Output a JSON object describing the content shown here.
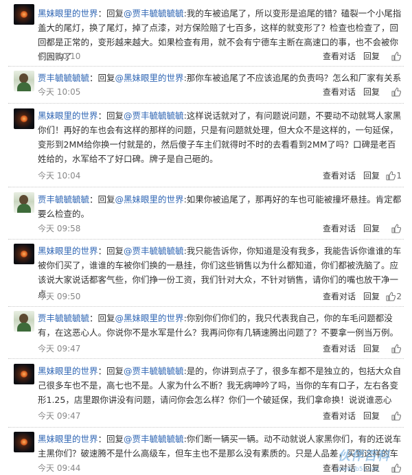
{
  "comments": [
    {
      "user": "黑妹眼里的世界",
      "sep": "：",
      "reply_prefix": "回复",
      "mention": "@贾丰毓毓毓毓",
      "text": ":我的车被追尾了，所以变形是追尾的错？磕裂一个小尾指盖大的尾灯，换了尾灯，掉了点漆，对方保险赔了七百多，这样的就变形了？检查也检查了，回回都是正常的，变形越来越大。如果检查有用，就不会有宁德车主断在高速口的事，也不会被你们回购了",
      "time": "今天 10:10",
      "view": "查看对话",
      "reply": "回复",
      "likes": ""
    },
    {
      "user": "贾丰毓毓毓毓",
      "sep": "：",
      "reply_prefix": "回复",
      "mention": "@黑妹眼里的世界",
      "text": ":那你车被追尾了不应该追尾的负责吗？怎么和厂家有关系",
      "time": "今天 10:05",
      "view": "查看对话",
      "reply": "回复",
      "likes": ""
    },
    {
      "user": "黑妹眼里的世界",
      "sep": "：",
      "reply_prefix": "回复",
      "mention": "@贾丰毓毓毓毓",
      "text": ":这样说话就对了，有问题说问题，不要动不动就骂人家黑你们！再好的车也会有这样的那样的问题，只是有问题就处理，但大众不是这样的，一句延保，变形到2MM给你换一付就是的，然后傻子车主们就得时不时的去看看到2MM了吗？口碑是老百姓给的，水军给不了好口碑。牌子是自己砸的。",
      "time": "今天 10:04",
      "view": "查看对话",
      "reply": "回复",
      "likes": "1"
    },
    {
      "user": "贾丰毓毓毓毓",
      "sep": "：",
      "reply_prefix": "回复",
      "mention": "@黑妹眼里的世界",
      "text": ":如果你被追尾了，那再好的车也可能被撞坏悬挂。肯定都要么检查的。",
      "time": "今天 09:58",
      "view": "查看对话",
      "reply": "回复",
      "likes": ""
    },
    {
      "user": "黑妹眼里的世界",
      "sep": "：",
      "reply_prefix": "回复",
      "mention": "@贾丰毓毓毓毓",
      "text": ":我只能告诉你，你知道是没有我多，我能告诉你谁谁的车被你们买了，谁谁的车被你们换的一悬挂，你们这些销售以为什么都知道，你们都被洗脑了。应该说大家说话都客气些，你们挣一份工资，我们针对大众，不针对销售，请你们的嘴也放干净一点",
      "time": "今天 09:50",
      "view": "查看对话",
      "reply": "回复",
      "likes": "2"
    },
    {
      "user": "贾丰毓毓毓毓",
      "sep": "：",
      "reply_prefix": "回复",
      "mention": "@黑妹眼里的世界",
      "text": ":你别你们你们的，我只代表我自己，你的车毛问题都没有，在这恶心人。你说你不是水军是什么？我再问你有几辆速腾出问题了？不要拿一例当万例。",
      "time": "今天 09:47",
      "view": "查看对话",
      "reply": "回复",
      "likes": ""
    },
    {
      "user": "黑妹眼里的世界",
      "sep": "：",
      "reply_prefix": "回复",
      "mention": "@贾丰毓毓毓毓",
      "text": ":是的，你讲到点子了，很多车都不是独立的，包括大众自己很多车也不是，高七也不是。人家为什么不断？我无病呻吟了吗，当你的车有口子，左右各变形1.25，店里跟你讲没有问题，请问你会怎么样？你们一个破延保，我们拿命换！说说谁恶心",
      "time": "今天 09:47",
      "view": "查看对话",
      "reply": "回复",
      "likes": ""
    },
    {
      "user": "黑妹眼里的世界",
      "sep": "：",
      "reply_prefix": "回复",
      "mention": "@贾丰毓毓毓毓",
      "text": ":你们断一辆买一辆。动不动就说人家黑你们，有的还说车主黑你们？破速腾不是什么高级车，但车主也不是那么没有素质的。只是人品差，买到这样的车",
      "time": "今天 09:44",
      "view": "查看对话",
      "reply": "回复",
      "likes": ""
    }
  ],
  "watermark": {
    "text": "伙伴百科",
    "sub": "www.jb51.net"
  }
}
